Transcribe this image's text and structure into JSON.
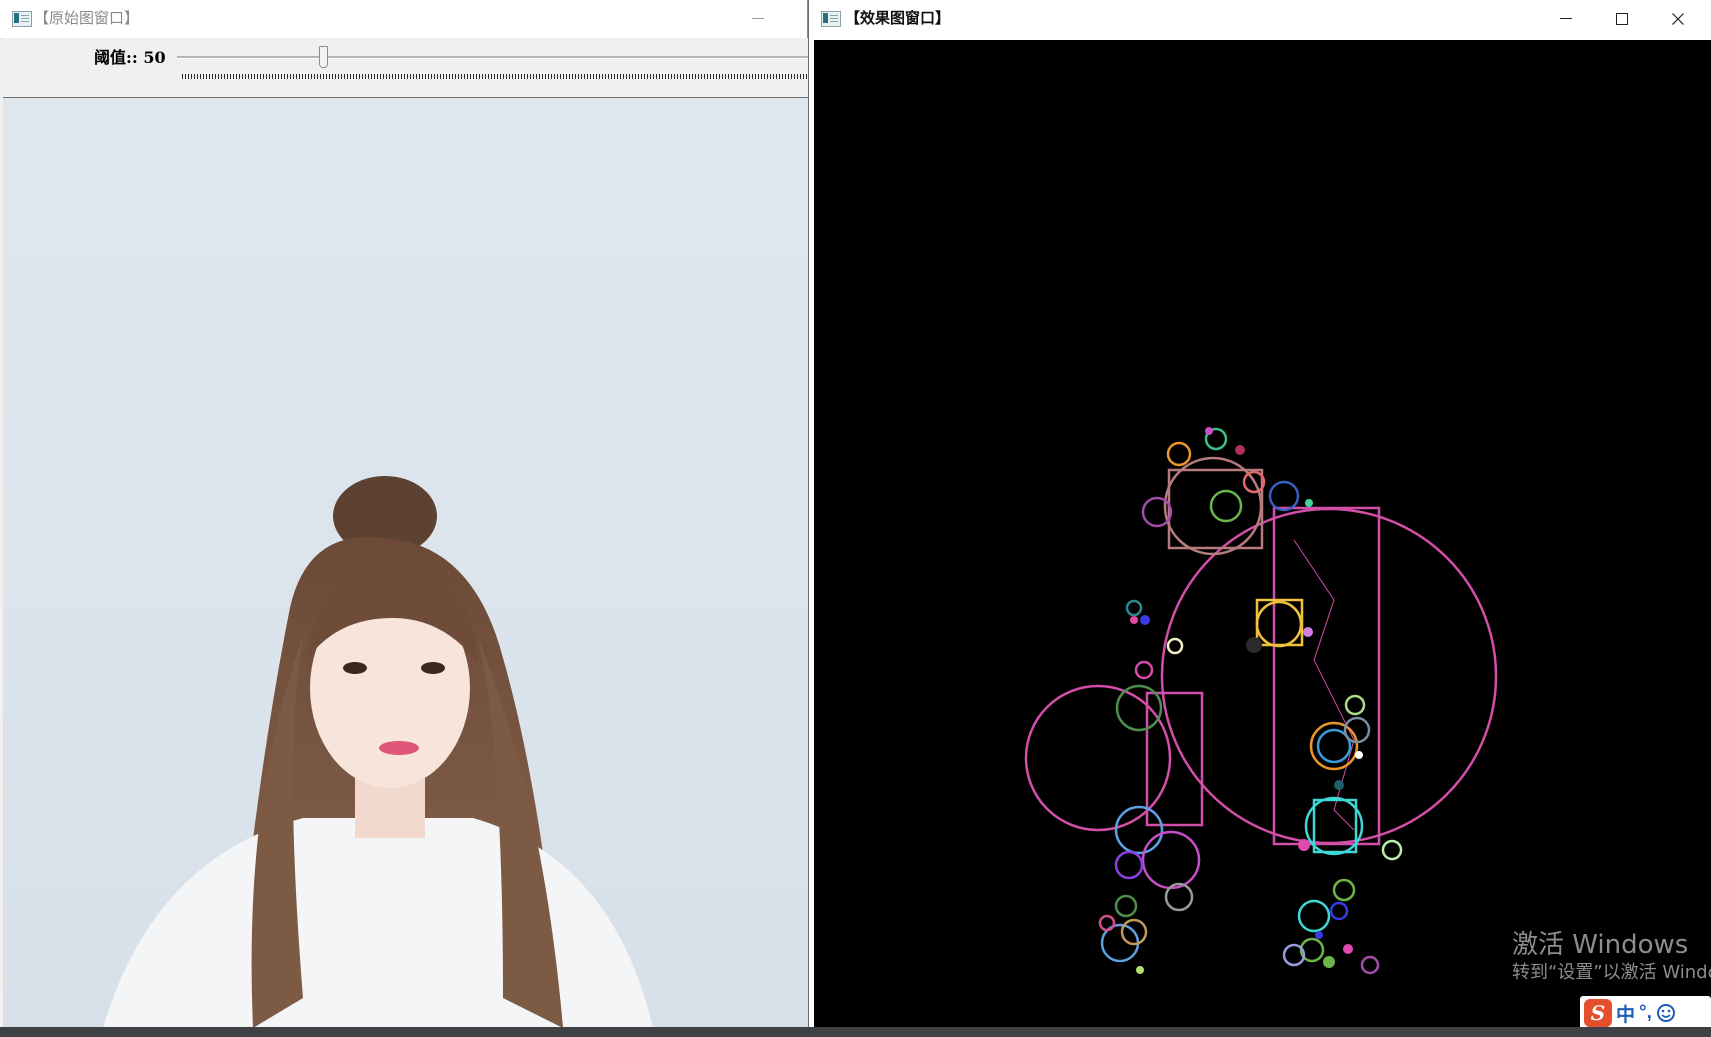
{
  "left_window": {
    "title": "【原始图窗口】",
    "trackbar": {
      "label": "阈值:: 50",
      "value": 50
    }
  },
  "right_window": {
    "title": "【效果图窗口】"
  },
  "watermark": {
    "title": "激活 Windows",
    "subtitle": "转到“设置”以激活 Windo"
  },
  "ime": {
    "logo": "S",
    "mode": "中",
    "punct": "°,"
  }
}
